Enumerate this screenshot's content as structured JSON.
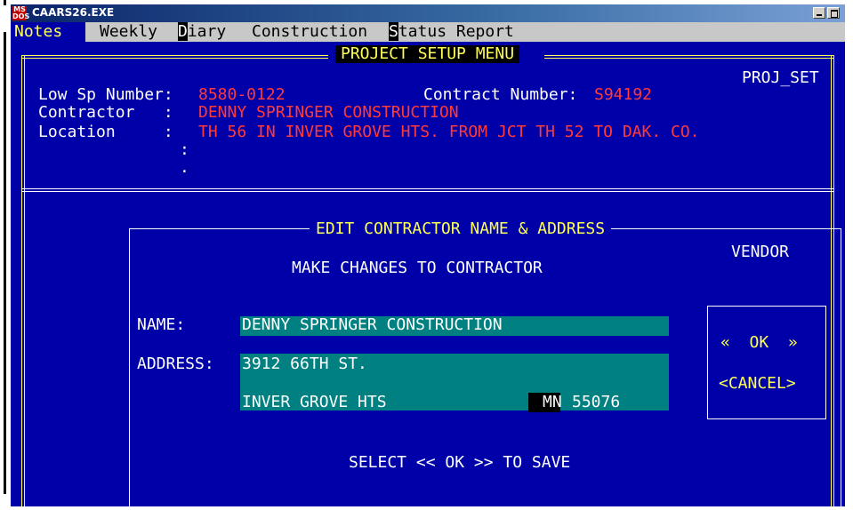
{
  "window": {
    "title": "CAARS26.EXE",
    "icon_text": "MS\nDOS"
  },
  "menubar": {
    "items": [
      {
        "label": "Notes",
        "hotkey": ""
      },
      {
        "label": "Weekly",
        "hotkey": ""
      },
      {
        "label": "Diary",
        "hotkey": "D",
        "rest": "iary"
      },
      {
        "label": "Construction",
        "hotkey": ""
      },
      {
        "label": "Status Report",
        "hotkey": "S",
        "rest": "tatus Report"
      }
    ]
  },
  "project_setup": {
    "menu_title": "PROJECT SETUP MENU",
    "screen_id": "PROJ_SET",
    "low_sp_label": "Low Sp Number:",
    "low_sp_value": "8580-0122",
    "contract_label": "Contract Number:",
    "contract_value": "S94192",
    "contractor_label": "Contractor   :",
    "contractor_value": "DENNY SPRINGER CONSTRUCTION",
    "location_label": "Location     :",
    "location_value": "TH 56 IN INVER GROVE HTS. FROM JCT TH 52 TO DAK. CO.",
    "location_cont": ":"
  },
  "edit_dialog": {
    "title": "EDIT CONTRACTOR NAME & ADDRESS",
    "vendor_label": "VENDOR",
    "instruction": "MAKE CHANGES TO CONTRACTOR",
    "name_label": "NAME:",
    "name_value": "DENNY SPRINGER CONSTRUCTION",
    "address_label": "ADDRESS:",
    "address_line1": "3912 66TH ST.",
    "city_value": "INVER GROVE HTS",
    "state_value": "MN",
    "zip_value": "55076",
    "ok_left": "«",
    "ok_label": "OK",
    "ok_right": "»",
    "cancel_label": "<CANCEL>",
    "footer": "SELECT << OK >> TO SAVE"
  },
  "colors": {
    "background": "#0000a8",
    "frame": "#ffff55",
    "field": "#008080",
    "value_text": "#ff3a3a"
  }
}
